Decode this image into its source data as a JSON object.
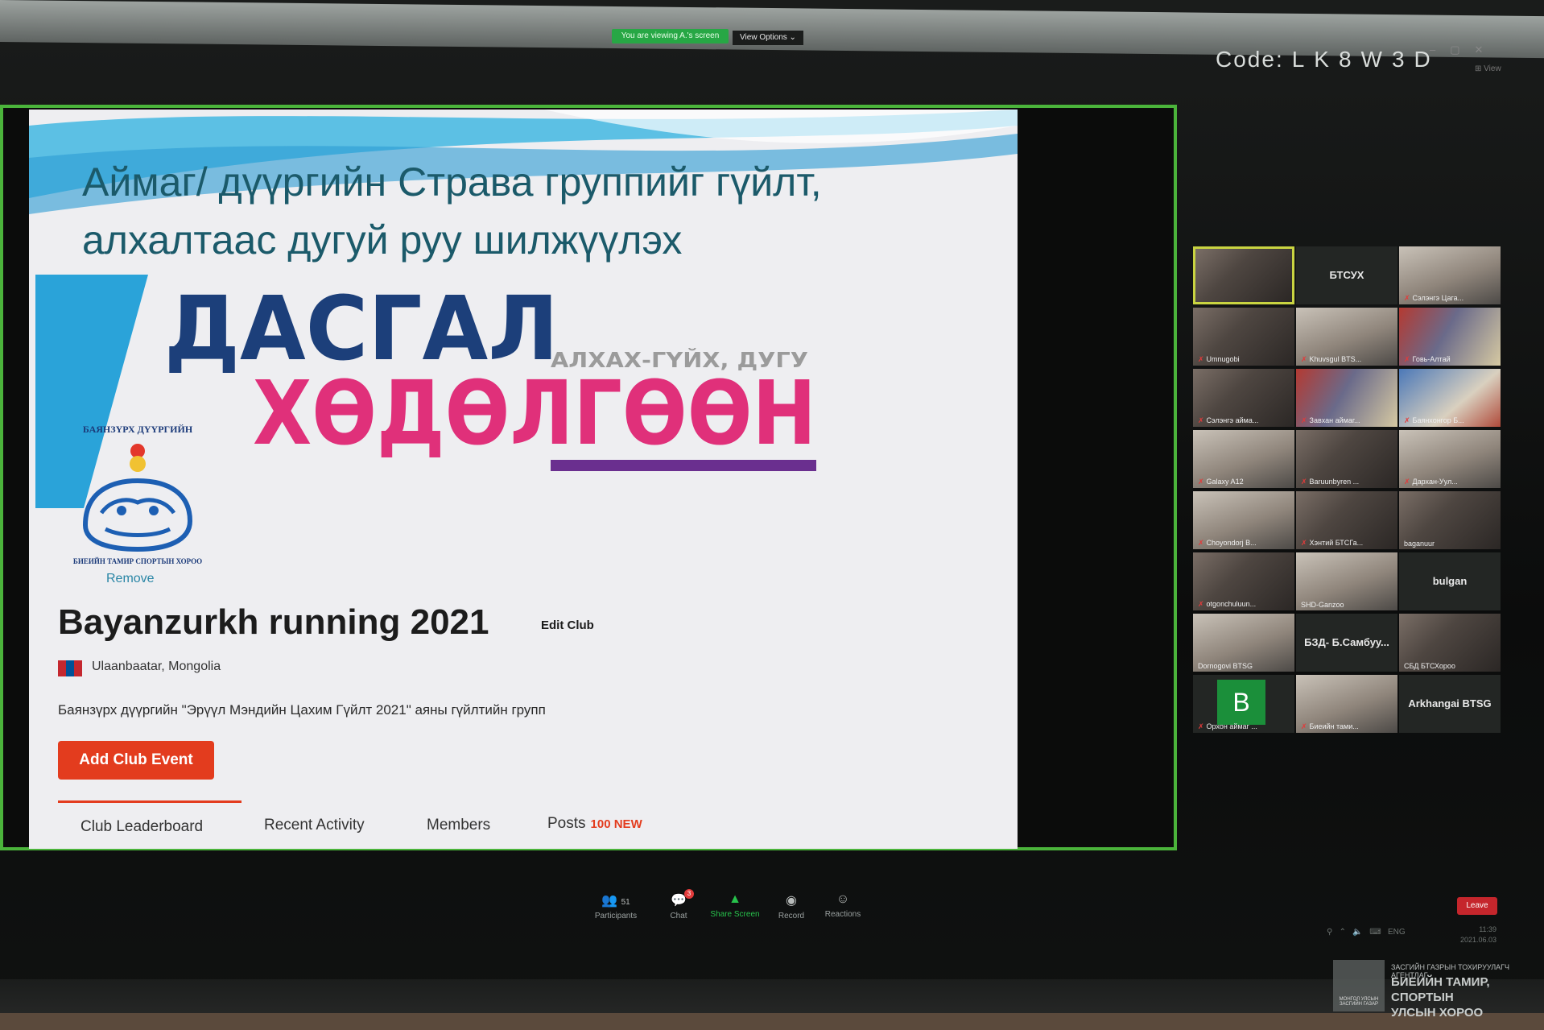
{
  "zoom": {
    "viewing_banner": "You are viewing A.'s screen",
    "view_options": "View Options ⌄",
    "code_label": "Code:",
    "code_value": "LK8W3D",
    "view_label": "View"
  },
  "slide": {
    "title_line1": "Аймаг/ дүүргийн Страва группийг гүйлт,",
    "title_line2": "алхалтаас дугуй руу шилжүүлэх",
    "banner_word1": "ДАСГАЛ",
    "banner_word2": "ХӨДӨЛГӨӨН",
    "banner_side": "АЛХАХ-ГҮЙХ, ДУГУ"
  },
  "club": {
    "logo_top_text": "БАЯНЗҮРХ ДҮҮРГИЙН",
    "logo_bottom_text": "БИЕИЙН ТАМИР СПОРТЫН ХОРОО",
    "remove": "Remove",
    "name": "Bayanzurkh running 2021",
    "edit": "Edit Club",
    "location": "Ulaanbaatar, Mongolia",
    "description": "Баянзүрх дүүргийн \"Эрүүл Мэндийн Цахим Гүйлт 2021\" аяны гүйлтийн групп",
    "add_event": "Add Club Event",
    "tabs": {
      "leaderboard": "Club Leaderboard",
      "activity": "Recent Activity",
      "members": "Members",
      "posts": "Posts",
      "posts_badge": "100 NEW"
    }
  },
  "participants": [
    {
      "name": ""
    },
    {
      "name": "БТСУХ"
    },
    {
      "name": "Сэлэнгэ Цага..."
    },
    {
      "name": "Umnugobi"
    },
    {
      "name": "Khuvsgul BTS..."
    },
    {
      "name": "Говь-Алтай"
    },
    {
      "name": "Сэлэнгэ айма..."
    },
    {
      "name": "Завхан аймаг..."
    },
    {
      "name": "Баянхонгор Б..."
    },
    {
      "name": "Galaxy A12"
    },
    {
      "name": "Baruunbyren ..."
    },
    {
      "name": "Дархан-Уул..."
    },
    {
      "name": "Choyondorj B..."
    },
    {
      "name": "Хэнтий БТСГа..."
    },
    {
      "name": "baganuur"
    },
    {
      "name": "otgonchuluun..."
    },
    {
      "name": "SHD-Ganzoo"
    },
    {
      "name": "bulgan"
    },
    {
      "name": "Dornogovi BTSG"
    },
    {
      "name": "БЗД- Б.Самбуу..."
    },
    {
      "name": "СБД БТСХороо"
    },
    {
      "name": "Орхон аймаг ..."
    },
    {
      "name": "Биеийн тами..."
    },
    {
      "name": "Arkhangai BTSG"
    }
  ],
  "avatar_letter": "B",
  "toolbar": {
    "participants_label": "Participants",
    "participants_count": "51",
    "chat_label": "Chat",
    "chat_badge": "3",
    "share_label": "Share Screen",
    "record_label": "Record",
    "reactions_label": "Reactions",
    "leave_label": "Leave"
  },
  "taskbar": {
    "lang": "ENG",
    "time": "11:39",
    "date": "2021.06.03"
  },
  "watermark": {
    "small": "ЗАСГИЙН ГАЗРЫН ТОХИРУУЛАГЧ АГЕНТЛАГ",
    "line1": "БИЕИЙН ТАМИР, СПОРТЫН",
    "line2": "УЛСЫН ХОРОО",
    "emblem_caption": "МОНГОЛ УЛСЫН ЗАСГИЙН ГАЗАР"
  },
  "colors": {
    "share_border": "#4bb43b",
    "strava_orange": "#e33c1e",
    "banner_navy": "#1c3f7a",
    "banner_pink": "#e0307a"
  }
}
